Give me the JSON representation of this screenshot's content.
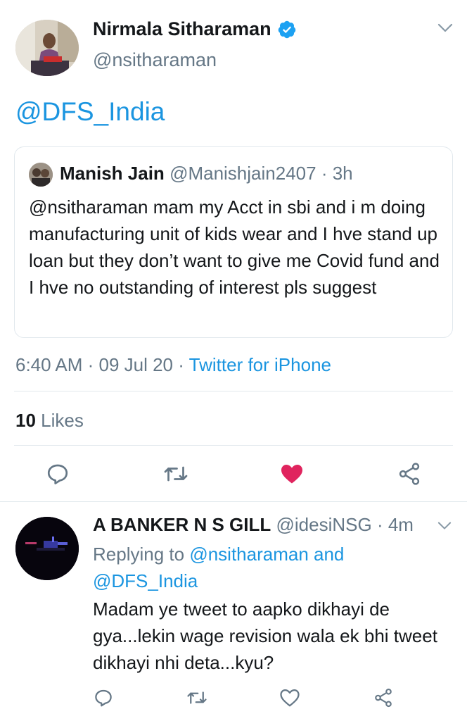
{
  "main_tweet": {
    "author_name": "Nirmala Sitharaman",
    "author_handle": "@nsitharaman",
    "text": "@DFS_India",
    "timestamp": "6:40 AM · 09 Jul 20 · ",
    "source": "Twitter for iPhone",
    "likes_count": "10",
    "likes_label": " Likes",
    "liked": true
  },
  "quoted_tweet": {
    "author_name": "Manish Jain",
    "author_handle": "@Manishjain2407",
    "age": " · 3h",
    "text": "@nsitharaman mam my Acct in sbi and i m doing manufacturing unit of kids wear and I hve stand up loan but they don’t want to give me Covid fund and I hve no outstanding of interest pls suggest"
  },
  "reply": {
    "author_name": "A BANKER N S GILL",
    "author_handle": "@idesiNSG",
    "age": " · 4m",
    "replying_prefix": "Replying to ",
    "replying_to": "@nsitharaman and @DFS_India",
    "text": "Madam ye tweet to aapko dikhayi de gya...lekin wage revision wala ek bhi tweet dikhayi nhi deta...kyu?"
  },
  "colors": {
    "accent": "#1b95e0",
    "secondary_text": "#657786",
    "like_red": "#e0245e",
    "divider": "#e1e8ed"
  },
  "icons": [
    "verified-badge-icon",
    "chevron-down-icon",
    "reply-icon",
    "retweet-icon",
    "like-icon",
    "share-icon"
  ]
}
